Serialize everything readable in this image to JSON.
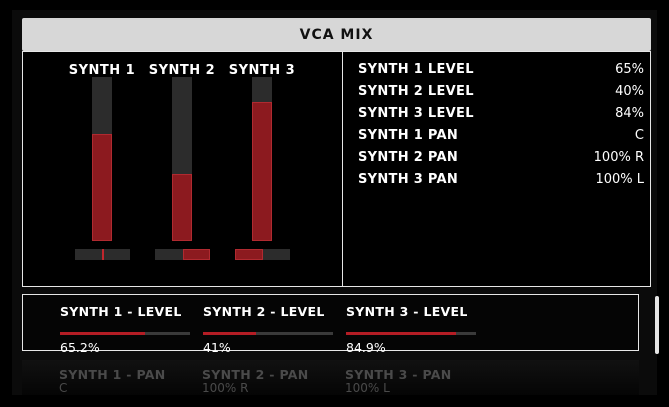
{
  "header": {
    "title": "VCA MIX"
  },
  "channels": [
    {
      "label": "SYNTH 1",
      "level": 0.652,
      "pan": 0.0,
      "pan_text": "C"
    },
    {
      "label": "SYNTH 2",
      "level": 0.41,
      "pan": 1.0,
      "pan_text": "100% R"
    },
    {
      "label": "SYNTH 3",
      "level": 0.849,
      "pan": -1.0,
      "pan_text": "100% L"
    }
  ],
  "params": [
    {
      "name": "SYNTH 1 LEVEL",
      "value": "65%"
    },
    {
      "name": "SYNTH 2 LEVEL",
      "value": "40%"
    },
    {
      "name": "SYNTH 3 LEVEL",
      "value": "84%"
    },
    {
      "name": "SYNTH 1 PAN",
      "value": "C"
    },
    {
      "name": "SYNTH 2 PAN",
      "value": "100% R"
    },
    {
      "name": "SYNTH 3 PAN",
      "value": "100% L"
    }
  ],
  "pages": {
    "active": [
      {
        "title": "SYNTH 1 - LEVEL",
        "value": "65.2%",
        "fill": 0.652
      },
      {
        "title": "SYNTH 2 - LEVEL",
        "value": "41%",
        "fill": 0.41
      },
      {
        "title": "SYNTH 3 - LEVEL",
        "value": "84.9%",
        "fill": 0.849
      }
    ],
    "inactive": [
      {
        "title": "SYNTH 1 - PAN",
        "value": "C"
      },
      {
        "title": "SYNTH 2 - PAN",
        "value": "100% R"
      },
      {
        "title": "SYNTH 3 - PAN",
        "value": "100% L"
      }
    ]
  },
  "colors": {
    "accent": "#8c1a1f",
    "accent_border": "#b02a30",
    "header_bg": "#d7d7d7",
    "track": "#2c2c2c"
  }
}
